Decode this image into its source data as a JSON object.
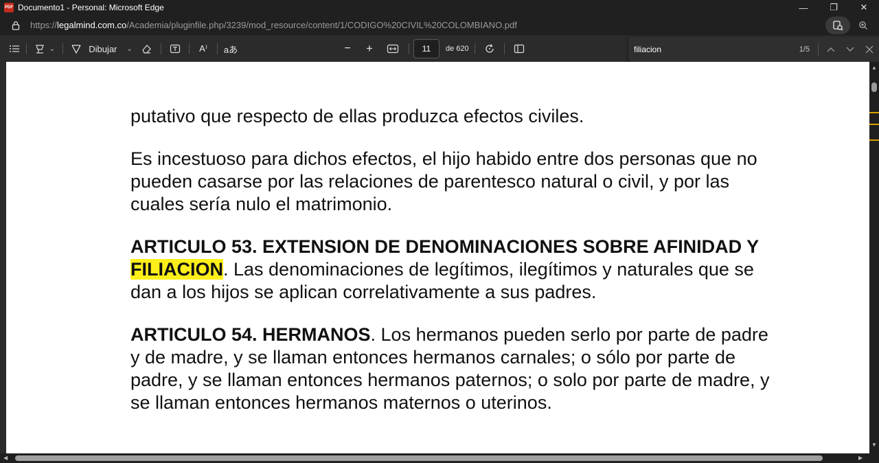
{
  "window": {
    "title": "Documento1 - Personal: Microsoft Edge",
    "app_icon_text": "PDF",
    "controls": {
      "minimize": "—",
      "restore": "❐",
      "close": "✕"
    }
  },
  "address": {
    "scheme": "https://",
    "host": "legalmind.com.co",
    "path": "/Academia/pluginfile.php/3239/mod_resource/content/1/CODIGO%20CIVIL%20COLOMBIANO.pdf"
  },
  "toolbar": {
    "draw_label": "Dibujar",
    "read_aloud_glyph": "A⁾",
    "translate_glyph": "aあ",
    "zoom_out": "−",
    "zoom_in": "+",
    "current_page": "11",
    "total_pages": "de 620"
  },
  "find": {
    "query": "filiacion",
    "count": "1/5"
  },
  "document": {
    "para1": "putativo que respecto de ellas produzca efectos civiles.",
    "para2": "Es incestuoso para dichos efectos, el hijo habido entre dos personas que no pueden casarse por las relaciones de parentesco natural o civil, y por las cuales sería nulo el matrimonio.",
    "art53_heading": "ARTICULO 53. EXTENSION DE DENOMINACIONES SOBRE AFINIDAD Y ",
    "art53_highlight": "FILIACION",
    "art53_text": ". Las denominaciones de legítimos, ilegítimos y naturales que se dan a los hijos se aplican correlativamente a sus padres.",
    "art54_heading": "ARTICULO 54. HERMANOS",
    "art54_text": ". Los hermanos pueden serlo por parte de padre y de madre, y se llaman entonces hermanos carnales; o sólo por parte de padre, y se llaman entonces hermanos paternos; o solo por parte de madre, y se llaman entonces hermanos maternos o uterinos."
  },
  "colors": {
    "highlight": "#ffef1a",
    "scroll_marker": "#d7a300"
  }
}
